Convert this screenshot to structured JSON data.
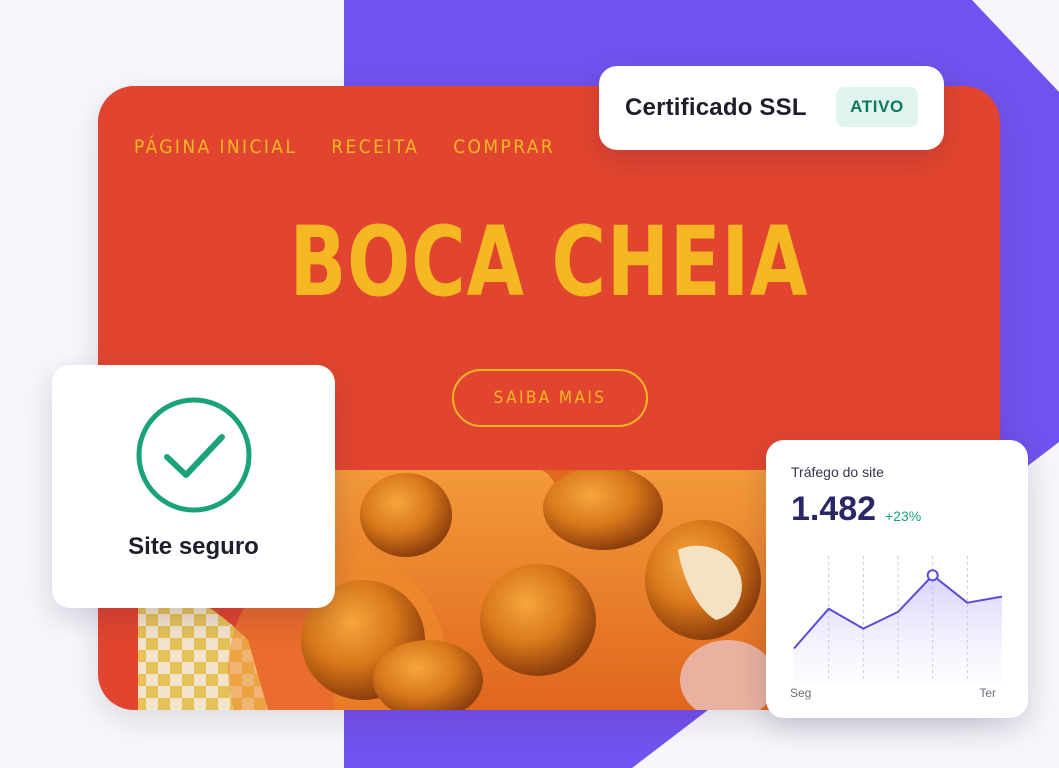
{
  "colors": {
    "page_background": "#f6f6fb",
    "purple_accent": "#7152ee",
    "card_red": "#e2452f",
    "brand_yellow": "#f5b823",
    "badge_green_bg": "#dff4ee",
    "badge_green_text": "#0d7a5f",
    "chart_line": "#5a4bd8",
    "positive_delta": "#1aa37a",
    "check_green": "#1aa37a"
  },
  "website": {
    "nav": [
      "PÁGINA INICIAL",
      "RECEITA",
      "COMPRAR"
    ],
    "hero_title": "BOCA CHEIA",
    "cta_label": "SAIBA MAIS",
    "photo": "fried-nuggets-photo"
  },
  "ssl_card": {
    "title": "Certificado SSL",
    "status": "ATIVO"
  },
  "secure_card": {
    "icon": "check-circle-icon",
    "label": "Site seguro"
  },
  "traffic_card": {
    "title": "Tráfego do site",
    "value": "1.482",
    "delta": "+23%",
    "x_start_label": "Seg",
    "x_end_label": "Ter"
  },
  "chart_data": {
    "type": "area",
    "title": "Tráfego do site",
    "xlabel": "",
    "ylabel": "",
    "x": [
      0,
      1,
      2,
      3,
      4,
      5,
      6
    ],
    "series": [
      {
        "values": [
          22,
          48,
          35,
          46,
          70,
          52,
          56
        ]
      }
    ],
    "ylim": [
      0,
      80
    ],
    "tick_labels_x": [
      "Seg",
      "Ter"
    ],
    "highlighted_index": 4,
    "grid": "vertical-dashed",
    "legend": "none"
  }
}
